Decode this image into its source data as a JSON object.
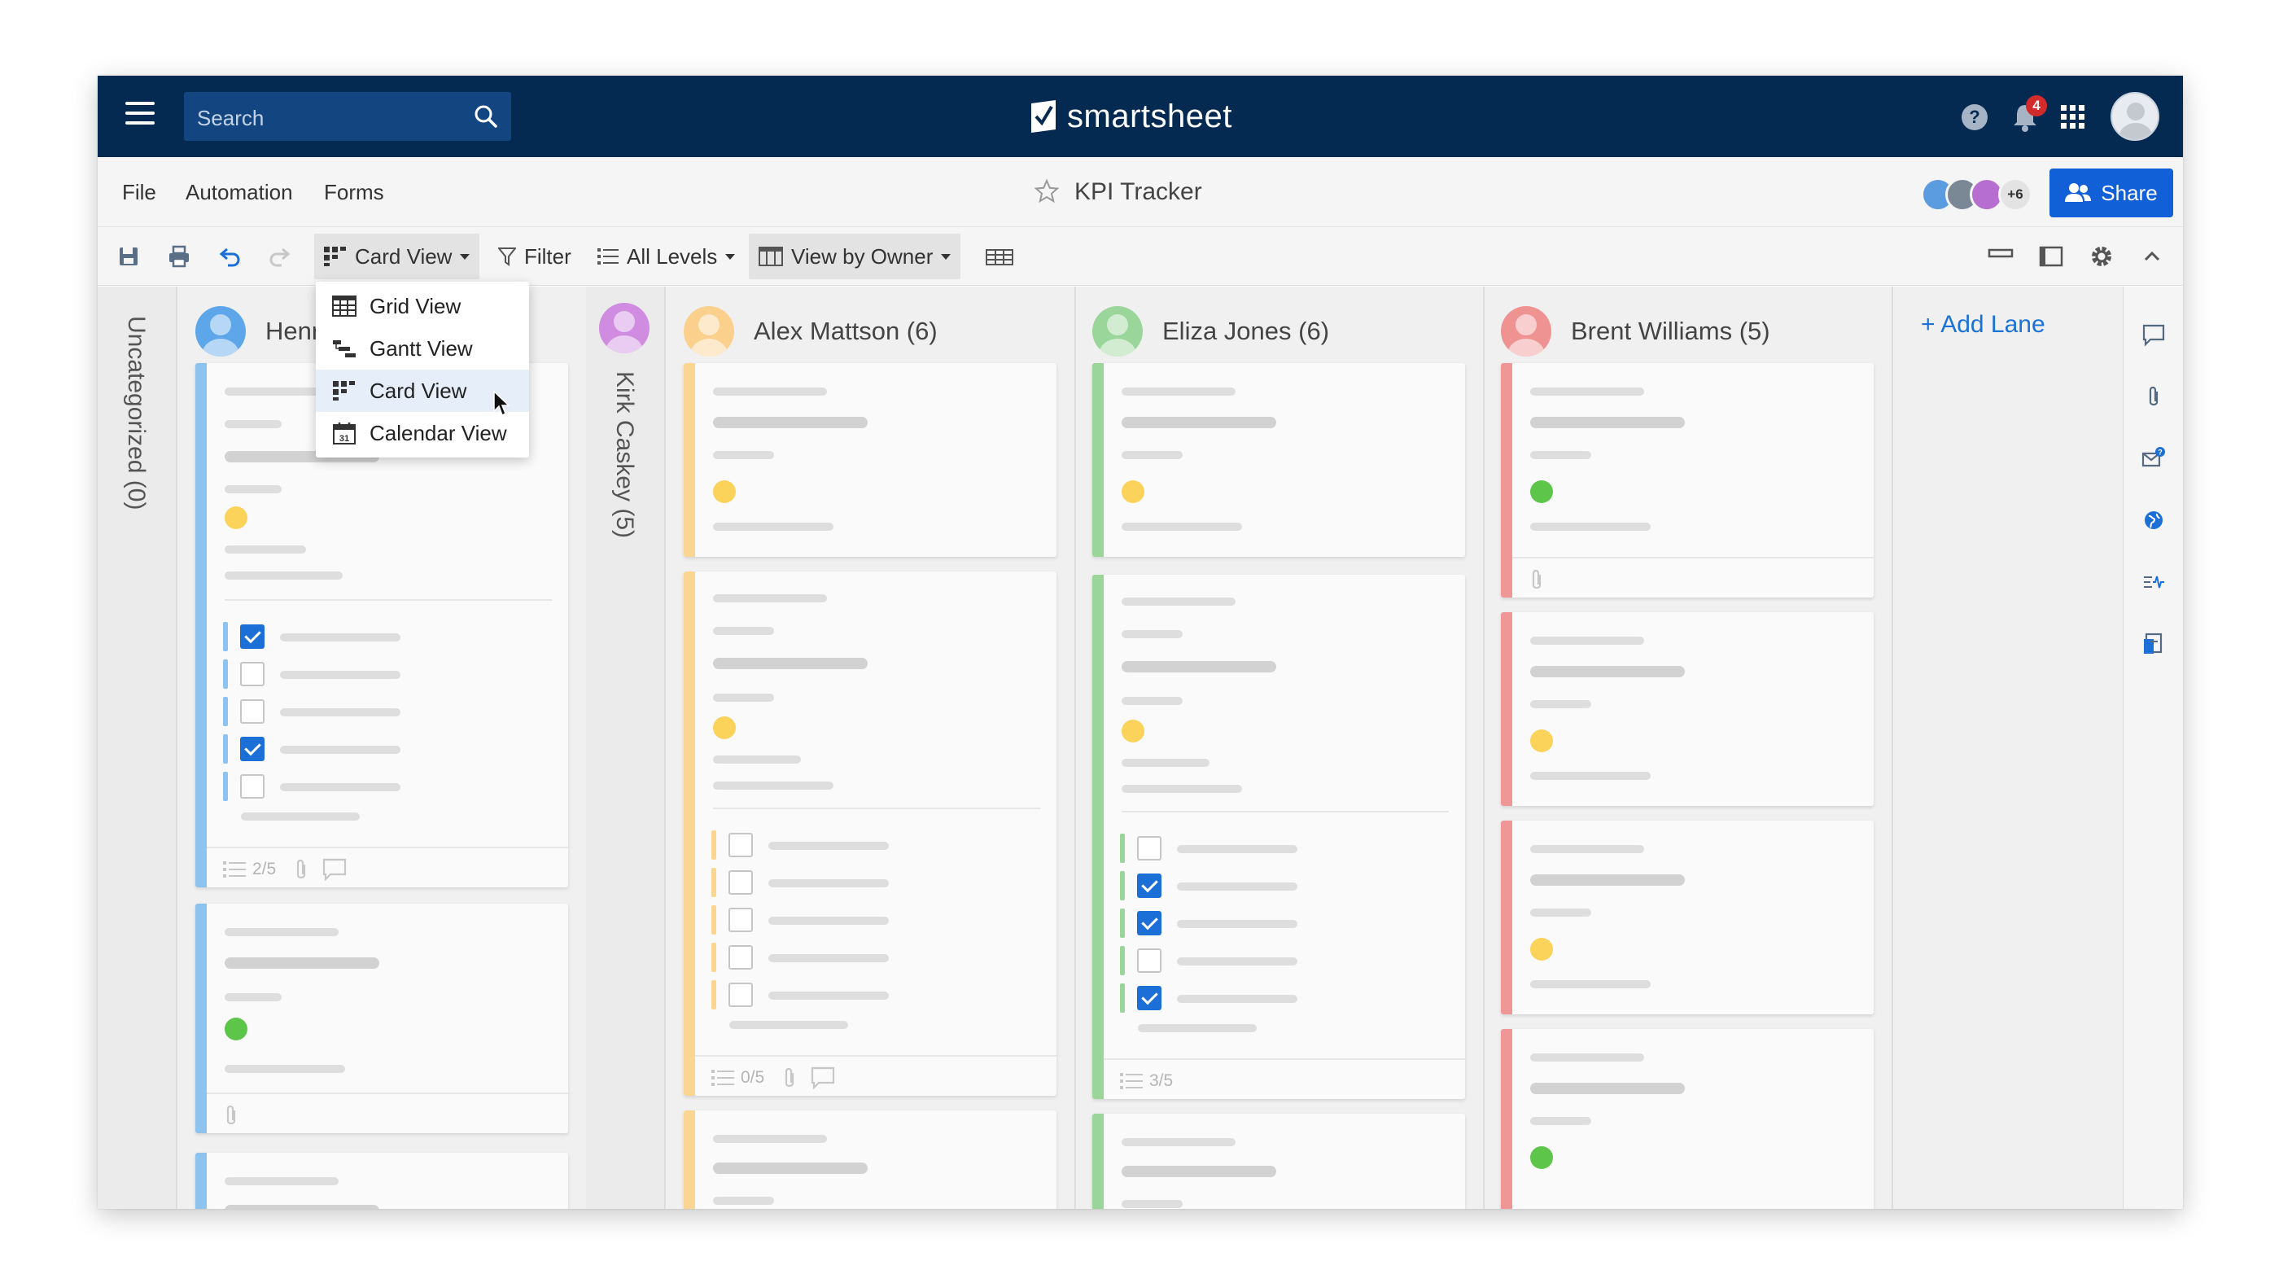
{
  "app": {
    "brand": "smartsheet",
    "search_placeholder": "Search",
    "notification_count": "4"
  },
  "menu": {
    "file": "File",
    "automation": "Automation",
    "forms": "Forms"
  },
  "sheet": {
    "title": "KPI Tracker"
  },
  "collaborators": {
    "extra_count": "+6"
  },
  "share": {
    "label": "Share"
  },
  "toolbar": {
    "view": "Card View",
    "filter": "Filter",
    "levels": "All Levels",
    "lanes": "View by Owner"
  },
  "view_menu": {
    "items": [
      "Grid View",
      "Gantt View",
      "Card View",
      "Calendar View"
    ],
    "selected": "Card View"
  },
  "lanes": {
    "uncategorized": "Uncategorized (0)",
    "henry": "Henr",
    "kirk": "Kirk Caskey (5)",
    "alex": "Alex Mattson (6)",
    "eliza": "Eliza Jones (6)",
    "brent": "Brent Williams (5)",
    "add_lane": "+ Add Lane"
  },
  "card_footers": {
    "henry_card1": "2/5",
    "alex_card2": "0/5",
    "eliza_card2": "3/5"
  },
  "colors": {
    "navy": "#052a52",
    "accent": "#1160d8",
    "lane_blue": "#8ec3ef",
    "lane_yellow": "#fbd592",
    "lane_green": "#9ad69a",
    "lane_red": "#ef9797",
    "dot_yellow": "#fbd25a",
    "dot_green": "#5cc54a"
  }
}
